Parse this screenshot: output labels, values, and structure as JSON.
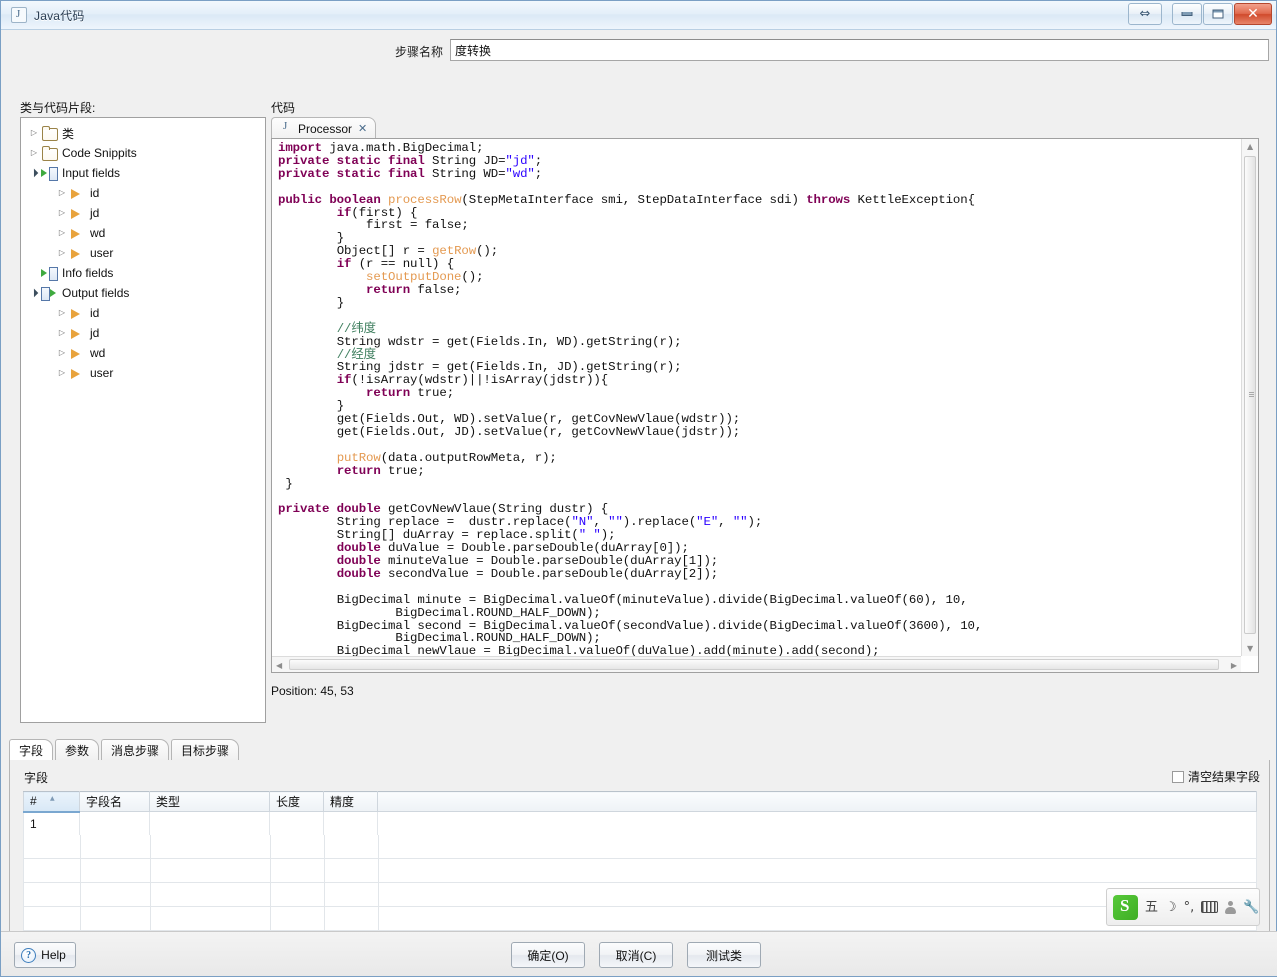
{
  "window": {
    "title": "Java代码",
    "icon": "java-file-icon",
    "controls": {
      "resize": "⇔",
      "minimize": "minimize",
      "maximize": "maximize",
      "close": "✕"
    }
  },
  "step": {
    "label": "步骤名称",
    "value": "度转换",
    "placeholder": ""
  },
  "sections": {
    "tree_label": "类与代码片段:",
    "code_label": "代码"
  },
  "tree": {
    "nodes": [
      {
        "label": "类",
        "icon": "folder-icon",
        "indent": 0,
        "expander": "collapsed"
      },
      {
        "label": "Code Snippits",
        "icon": "folder-icon",
        "indent": 0,
        "expander": "collapsed"
      },
      {
        "label": "Input fields",
        "icon": "input-fields-icon",
        "indent": 0,
        "expander": "expanded"
      },
      {
        "label": "id",
        "icon": "field-icon",
        "indent": 1,
        "expander": "collapsed"
      },
      {
        "label": "jd",
        "icon": "field-icon",
        "indent": 1,
        "expander": "collapsed"
      },
      {
        "label": "wd",
        "icon": "field-icon",
        "indent": 1,
        "expander": "collapsed"
      },
      {
        "label": "user",
        "icon": "field-icon",
        "indent": 1,
        "expander": "collapsed"
      },
      {
        "label": "Info fields",
        "icon": "input-fields-icon",
        "indent": 0,
        "expander": "none"
      },
      {
        "label": "Output fields",
        "icon": "output-fields-icon",
        "indent": 0,
        "expander": "expanded"
      },
      {
        "label": "id",
        "icon": "field-icon",
        "indent": 1,
        "expander": "collapsed"
      },
      {
        "label": "jd",
        "icon": "field-icon",
        "indent": 1,
        "expander": "collapsed"
      },
      {
        "label": "wd",
        "icon": "field-icon",
        "indent": 1,
        "expander": "collapsed"
      },
      {
        "label": "user",
        "icon": "field-icon",
        "indent": 1,
        "expander": "collapsed"
      }
    ]
  },
  "editor": {
    "tab_label": "Processor",
    "tab_close": "✕",
    "position_text": "Position: 45, 53",
    "code_lines": [
      {
        "indent": 0,
        "tokens": [
          {
            "t": "import",
            "c": "kw"
          },
          {
            "t": " java.math.BigDecimal;",
            "c": ""
          }
        ]
      },
      {
        "indent": 0,
        "tokens": [
          {
            "t": "private static final",
            "c": "kw"
          },
          {
            "t": " String JD=",
            "c": ""
          },
          {
            "t": "\"jd\"",
            "c": "str"
          },
          {
            "t": ";",
            "c": ""
          }
        ]
      },
      {
        "indent": 0,
        "tokens": [
          {
            "t": "private static final",
            "c": "kw"
          },
          {
            "t": " String WD=",
            "c": ""
          },
          {
            "t": "\"wd\"",
            "c": "str"
          },
          {
            "t": ";",
            "c": ""
          }
        ]
      },
      {
        "indent": 0,
        "tokens": []
      },
      {
        "indent": 0,
        "tokens": [
          {
            "t": "public boolean",
            "c": "kw"
          },
          {
            "t": " ",
            "c": ""
          },
          {
            "t": "processRow",
            "c": "mth"
          },
          {
            "t": "(StepMetaInterface smi, StepDataInterface sdi) ",
            "c": ""
          },
          {
            "t": "throws",
            "c": "kw"
          },
          {
            "t": " KettleException{",
            "c": ""
          }
        ]
      },
      {
        "indent": 2,
        "tokens": [
          {
            "t": "if",
            "c": "kw"
          },
          {
            "t": "(first) {",
            "c": ""
          }
        ]
      },
      {
        "indent": 3,
        "tokens": [
          {
            "t": "first = false;",
            "c": ""
          }
        ]
      },
      {
        "indent": 2,
        "tokens": [
          {
            "t": "}",
            "c": ""
          }
        ]
      },
      {
        "indent": 2,
        "tokens": [
          {
            "t": "Object[] r = ",
            "c": ""
          },
          {
            "t": "getRow",
            "c": "mth"
          },
          {
            "t": "();",
            "c": ""
          }
        ]
      },
      {
        "indent": 2,
        "tokens": [
          {
            "t": "if",
            "c": "kw"
          },
          {
            "t": " (r == null) {",
            "c": ""
          }
        ]
      },
      {
        "indent": 3,
        "tokens": [
          {
            "t": "setOutputDone",
            "c": "mth"
          },
          {
            "t": "();",
            "c": ""
          }
        ]
      },
      {
        "indent": 3,
        "tokens": [
          {
            "t": "return",
            "c": "kw"
          },
          {
            "t": " false;",
            "c": ""
          }
        ]
      },
      {
        "indent": 2,
        "tokens": [
          {
            "t": "}",
            "c": ""
          }
        ]
      },
      {
        "indent": 0,
        "tokens": []
      },
      {
        "indent": 2,
        "tokens": [
          {
            "t": "//纬度",
            "c": "cmt"
          }
        ]
      },
      {
        "indent": 2,
        "tokens": [
          {
            "t": "String wdstr = get(Fields.In, WD).getString(r);",
            "c": ""
          }
        ]
      },
      {
        "indent": 2,
        "tokens": [
          {
            "t": "//经度",
            "c": "cmt"
          }
        ]
      },
      {
        "indent": 2,
        "tokens": [
          {
            "t": "String jdstr = get(Fields.In, JD).getString(r);",
            "c": ""
          }
        ]
      },
      {
        "indent": 2,
        "tokens": [
          {
            "t": "if",
            "c": "kw"
          },
          {
            "t": "(!isArray(wdstr)||!isArray(jdstr)){",
            "c": ""
          }
        ]
      },
      {
        "indent": 3,
        "tokens": [
          {
            "t": "return",
            "c": "kw"
          },
          {
            "t": " true;",
            "c": ""
          }
        ]
      },
      {
        "indent": 2,
        "tokens": [
          {
            "t": "}",
            "c": ""
          }
        ]
      },
      {
        "indent": 2,
        "tokens": [
          {
            "t": "get(Fields.Out, WD).setValue(r, getCovNewVlaue(wdstr));",
            "c": ""
          }
        ]
      },
      {
        "indent": 2,
        "tokens": [
          {
            "t": "get(Fields.Out, JD).setValue(r, getCovNewVlaue(jdstr));",
            "c": ""
          }
        ]
      },
      {
        "indent": 0,
        "tokens": []
      },
      {
        "indent": 2,
        "tokens": [
          {
            "t": "putRow",
            "c": "mth"
          },
          {
            "t": "(data.outputRowMeta, r);",
            "c": ""
          }
        ]
      },
      {
        "indent": 2,
        "tokens": [
          {
            "t": "return",
            "c": "kw"
          },
          {
            "t": " true;",
            "c": ""
          }
        ]
      },
      {
        "indent": 0,
        "tokens": [
          {
            "t": " }",
            "c": ""
          }
        ]
      },
      {
        "indent": 0,
        "tokens": []
      },
      {
        "indent": 0,
        "tokens": [
          {
            "t": "private double",
            "c": "kw"
          },
          {
            "t": " getCovNewVlaue(String dustr) {",
            "c": ""
          }
        ]
      },
      {
        "indent": 2,
        "tokens": [
          {
            "t": "String replace =  dustr.replace(",
            "c": ""
          },
          {
            "t": "\"N\"",
            "c": "str"
          },
          {
            "t": ", ",
            "c": ""
          },
          {
            "t": "\"\"",
            "c": "str"
          },
          {
            "t": ").replace(",
            "c": ""
          },
          {
            "t": "\"E\"",
            "c": "str"
          },
          {
            "t": ", ",
            "c": ""
          },
          {
            "t": "\"\"",
            "c": "str"
          },
          {
            "t": ");",
            "c": ""
          }
        ]
      },
      {
        "indent": 2,
        "tokens": [
          {
            "t": "String[] duArray = replace.split(",
            "c": ""
          },
          {
            "t": "\" \"",
            "c": "str"
          },
          {
            "t": ");",
            "c": ""
          }
        ]
      },
      {
        "indent": 2,
        "tokens": [
          {
            "t": "double",
            "c": "kw"
          },
          {
            "t": " duValue = Double.parseDouble(duArray[0]);",
            "c": ""
          }
        ]
      },
      {
        "indent": 2,
        "tokens": [
          {
            "t": "double",
            "c": "kw"
          },
          {
            "t": " minuteValue = Double.parseDouble(duArray[1]);",
            "c": ""
          }
        ]
      },
      {
        "indent": 2,
        "tokens": [
          {
            "t": "double",
            "c": "kw"
          },
          {
            "t": " secondValue = Double.parseDouble(duArray[2]);",
            "c": ""
          }
        ]
      },
      {
        "indent": 0,
        "tokens": []
      },
      {
        "indent": 2,
        "tokens": [
          {
            "t": "BigDecimal minute = BigDecimal.valueOf(minuteValue).divide(BigDecimal.valueOf(60), 10,",
            "c": ""
          }
        ]
      },
      {
        "indent": 4,
        "tokens": [
          {
            "t": "BigDecimal.ROUND_HALF_DOWN);",
            "c": ""
          }
        ]
      },
      {
        "indent": 2,
        "tokens": [
          {
            "t": "BigDecimal second = BigDecimal.valueOf(secondValue).divide(BigDecimal.valueOf(3600), 10,",
            "c": ""
          }
        ]
      },
      {
        "indent": 4,
        "tokens": [
          {
            "t": "BigDecimal.ROUND_HALF_DOWN);",
            "c": ""
          }
        ]
      },
      {
        "indent": 2,
        "tokens": [
          {
            "t": "BigDecimal newVlaue = BigDecimal.valueOf(duValue).add(minute).add(second);",
            "c": ""
          }
        ]
      }
    ]
  },
  "lower_tabs": [
    {
      "label": "字段",
      "active": true
    },
    {
      "label": "参数",
      "active": false
    },
    {
      "label": "消息步骤",
      "active": false
    },
    {
      "label": "目标步骤",
      "active": false
    }
  ],
  "fields_panel": {
    "caption": "字段",
    "clear_checkbox_label": "清空结果字段",
    "clear_checkbox_checked": false,
    "columns": [
      "#",
      "字段名",
      "类型",
      "长度",
      "精度",
      ""
    ],
    "rows": [
      {
        "num": "1",
        "name": "",
        "type": "",
        "length": "",
        "precision": "",
        "extra": ""
      }
    ]
  },
  "ime": {
    "logo": "sogou-logo",
    "items": [
      "五",
      "☽",
      "°,",
      "keyboard-icon",
      "person-icon",
      "wrench-icon"
    ]
  },
  "footer": {
    "help": "Help",
    "ok": "确定(O)",
    "cancel": "取消(C)",
    "test": "测试类"
  }
}
